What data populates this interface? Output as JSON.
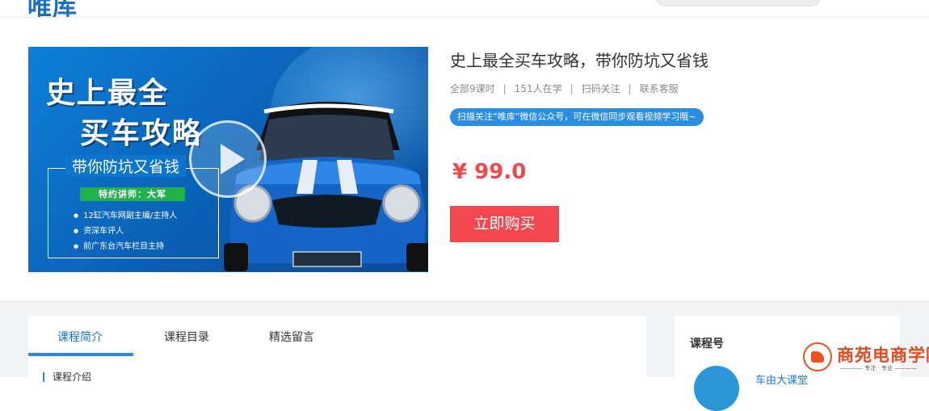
{
  "header": {
    "logo_text": "唯库"
  },
  "cover": {
    "title_line1": "史上最全",
    "title_line2": "买车攻略",
    "subtitle": "带你防坑又省钱",
    "teacher_badge": "特约讲师：大军",
    "bullets": [
      "12缸汽车网副主编/主持人",
      "资深车评人",
      "前广东台汽车栏目主持"
    ]
  },
  "course": {
    "title": "史上最全买车攻略，带你防坑又省钱",
    "meta": [
      "全部9课时",
      "151人在学",
      "扫码关注",
      "联系客服"
    ],
    "notice": "扫描关注“唯库”微信公众号，可在微信同步观看视频学习哦~",
    "price": "¥ 99.0",
    "buy_label": "立即购买"
  },
  "tabs": {
    "items": [
      {
        "label": "课程简介",
        "active": true
      },
      {
        "label": "课程目录",
        "active": false
      },
      {
        "label": "精选留言",
        "active": false
      }
    ],
    "section_label": "课程介绍"
  },
  "side": {
    "title": "课程号",
    "account_name": "车由大课堂"
  },
  "watermark": {
    "name": "商苑电商学院",
    "slogan": "———— 专注 · 专业 ————"
  },
  "colors": {
    "brand_blue": "#1a6fc4",
    "price_red": "#f0484e",
    "buy_red": "#f44750",
    "notice_blue": "#2b8de0",
    "teacher_green": "#22b24c"
  },
  "icons": {
    "play": "play-icon",
    "watermark_logo": "watermark-logo-icon"
  }
}
